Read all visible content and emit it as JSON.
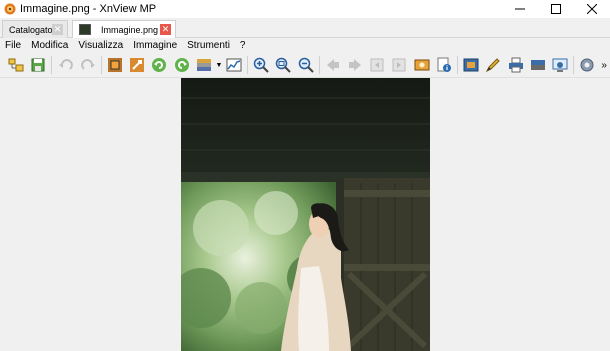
{
  "window": {
    "title": "Immagine.png - XnView MP",
    "icon": "xnview-icon",
    "controls": [
      "minimize-icon",
      "maximize-icon",
      "close-icon"
    ]
  },
  "tabs": [
    {
      "label": "Catalogatore",
      "active": false
    },
    {
      "label": "Immagine.png",
      "active": true
    }
  ],
  "menu": [
    "File",
    "Modifica",
    "Visualizza",
    "Immagine",
    "Strumenti",
    "?"
  ],
  "toolbar": {
    "icons": [
      "browser-icon",
      "save-icon",
      "undo-icon",
      "redo-icon",
      "crop-icon",
      "resize-icon",
      "rotate-left-icon",
      "rotate-right-icon",
      "color-adjust-icon",
      "levels-icon",
      "zoom-in-icon",
      "zoom-fit-icon",
      "zoom-out-icon",
      "previous-icon",
      "next-icon",
      "first-page-icon",
      "last-page-icon",
      "slideshow-icon",
      "info-icon",
      "fullscreen-icon",
      "edit-icon",
      "print-icon",
      "scanner-icon",
      "screen-capture-icon",
      "settings-icon",
      "more-icon"
    ],
    "overflow_glyph": "»"
  },
  "viewer": {
    "image_name": "Immagine.png",
    "background": "#f0f0f0"
  }
}
